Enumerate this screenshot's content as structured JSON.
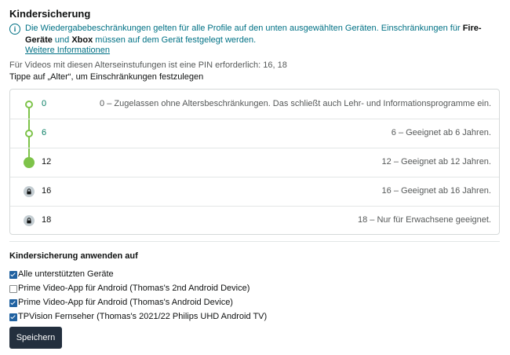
{
  "section_title": "Kindersicherung",
  "info": {
    "text_part1": "Die Wiedergabebeschränkungen gelten für alle Profile auf den unten ausgewählten Geräten. Einschränkungen für ",
    "bold1": "Fire-Geräte",
    "text_part2": " und ",
    "bold2": "Xbox",
    "text_part3": " müssen auf dem Gerät festgelegt werden.",
    "link": "Weitere Informationen",
    "icon": "info-icon",
    "color": "#007185"
  },
  "pin_text": "Für Videos mit diesen Alterseinstufungen ist eine PIN erforderlich: 16, 18",
  "instruction": "Tippe auf „Alter“, um Einschränkungen festzulegen",
  "ratings": [
    {
      "age": "0",
      "desc": "0 – Zugelassen ohne Altersbeschränkungen. Das schließt auch Lehr- und Informationsprogramme ein.",
      "state": "allowed"
    },
    {
      "age": "6",
      "desc": "6 – Geeignet ab 6 Jahren.",
      "state": "allowed"
    },
    {
      "age": "12",
      "desc": "12 – Geeignet ab 12 Jahren.",
      "state": "selected"
    },
    {
      "age": "16",
      "desc": "16 – Geeignet ab 16 Jahren.",
      "state": "locked"
    },
    {
      "age": "18",
      "desc": "18 – Nur für Erwachsene geeignet.",
      "state": "locked"
    }
  ],
  "apply_title": "Kindersicherung anwenden auf",
  "devices": [
    {
      "label": "Alle unterstützten Geräte",
      "checked": true
    },
    {
      "label": "Prime Video-App für Android (Thomas's 2nd Android Device)",
      "checked": false
    },
    {
      "label": "Prime Video-App für Android (Thomas's Android Device)",
      "checked": true
    },
    {
      "label": "TPVision Fernseher (Thomas's 2021/22 Philips UHD Android TV)",
      "checked": true
    }
  ],
  "save_label": "Speichern",
  "colors": {
    "accent_green": "#7ec34a",
    "link_teal": "#007185",
    "button_dark": "#232f3e",
    "checkbox_blue": "#2162a1"
  }
}
